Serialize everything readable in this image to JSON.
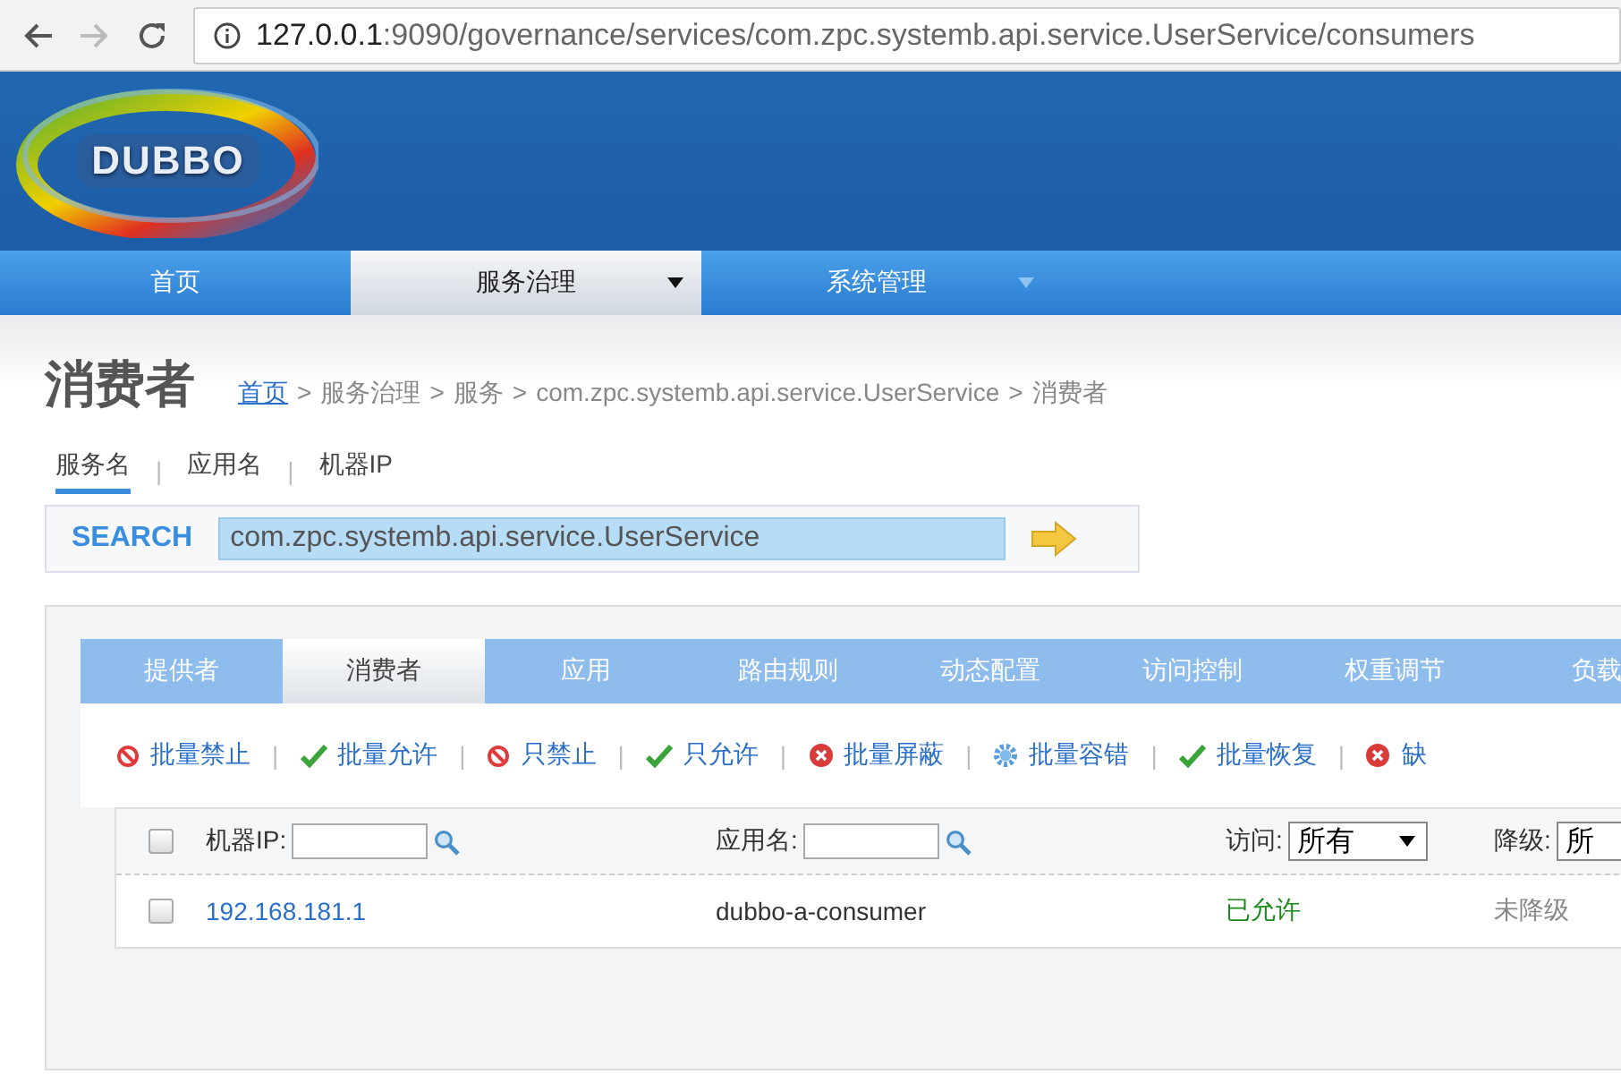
{
  "browser": {
    "url_host": "127.0.0.1",
    "url_rest": ":9090/governance/services/com.zpc.systemb.api.service.UserService/consumers"
  },
  "logo": {
    "text": "DUBBO"
  },
  "nav": [
    {
      "label": "首页",
      "selected": false,
      "dropdown": false
    },
    {
      "label": "服务治理",
      "selected": true,
      "dropdown": true
    },
    {
      "label": "系统管理",
      "selected": false,
      "dropdown": true
    }
  ],
  "page_title": "消费者",
  "breadcrumb": [
    {
      "label": "首页",
      "link": true
    },
    {
      "label": "服务治理",
      "link": false
    },
    {
      "label": "服务",
      "link": false
    },
    {
      "label": "com.zpc.systemb.api.service.UserService",
      "link": false
    },
    {
      "label": "消费者",
      "link": false
    }
  ],
  "breadcrumb_separator": ">",
  "search_tabs": [
    {
      "label": "服务名",
      "selected": true
    },
    {
      "label": "应用名",
      "selected": false
    },
    {
      "label": "机器IP",
      "selected": false
    }
  ],
  "search_tab_separator": "|",
  "search": {
    "label": "SEARCH",
    "value": "com.zpc.systemb.api.service.UserService"
  },
  "tabs": [
    {
      "label": "提供者",
      "selected": false
    },
    {
      "label": "消费者",
      "selected": true
    },
    {
      "label": "应用",
      "selected": false
    },
    {
      "label": "路由规则",
      "selected": false
    },
    {
      "label": "动态配置",
      "selected": false
    },
    {
      "label": "访问控制",
      "selected": false
    },
    {
      "label": "权重调节",
      "selected": false
    },
    {
      "label": "负载",
      "selected": false
    }
  ],
  "actions": [
    {
      "label": "批量禁止",
      "kind": "ban"
    },
    {
      "label": "批量允许",
      "kind": "check"
    },
    {
      "label": "只禁止",
      "kind": "ban"
    },
    {
      "label": "只允许",
      "kind": "check"
    },
    {
      "label": "批量屏蔽",
      "kind": "remove"
    },
    {
      "label": "批量容错",
      "kind": "gear"
    },
    {
      "label": "批量恢复",
      "kind": "check"
    },
    {
      "label": "缺",
      "kind": "remove"
    }
  ],
  "action_separator": "|",
  "table": {
    "header": {
      "checked": false,
      "ip_label": "机器IP:",
      "app_label": "应用名:",
      "access_label": "访问:",
      "access_value": "所有",
      "degrade_label": "降级:",
      "degrade_value": "所"
    },
    "rows": [
      {
        "checked": false,
        "ip": "192.168.181.1",
        "app": "dubbo-a-consumer",
        "access": "已允许",
        "degrade": "未降级"
      }
    ]
  }
}
